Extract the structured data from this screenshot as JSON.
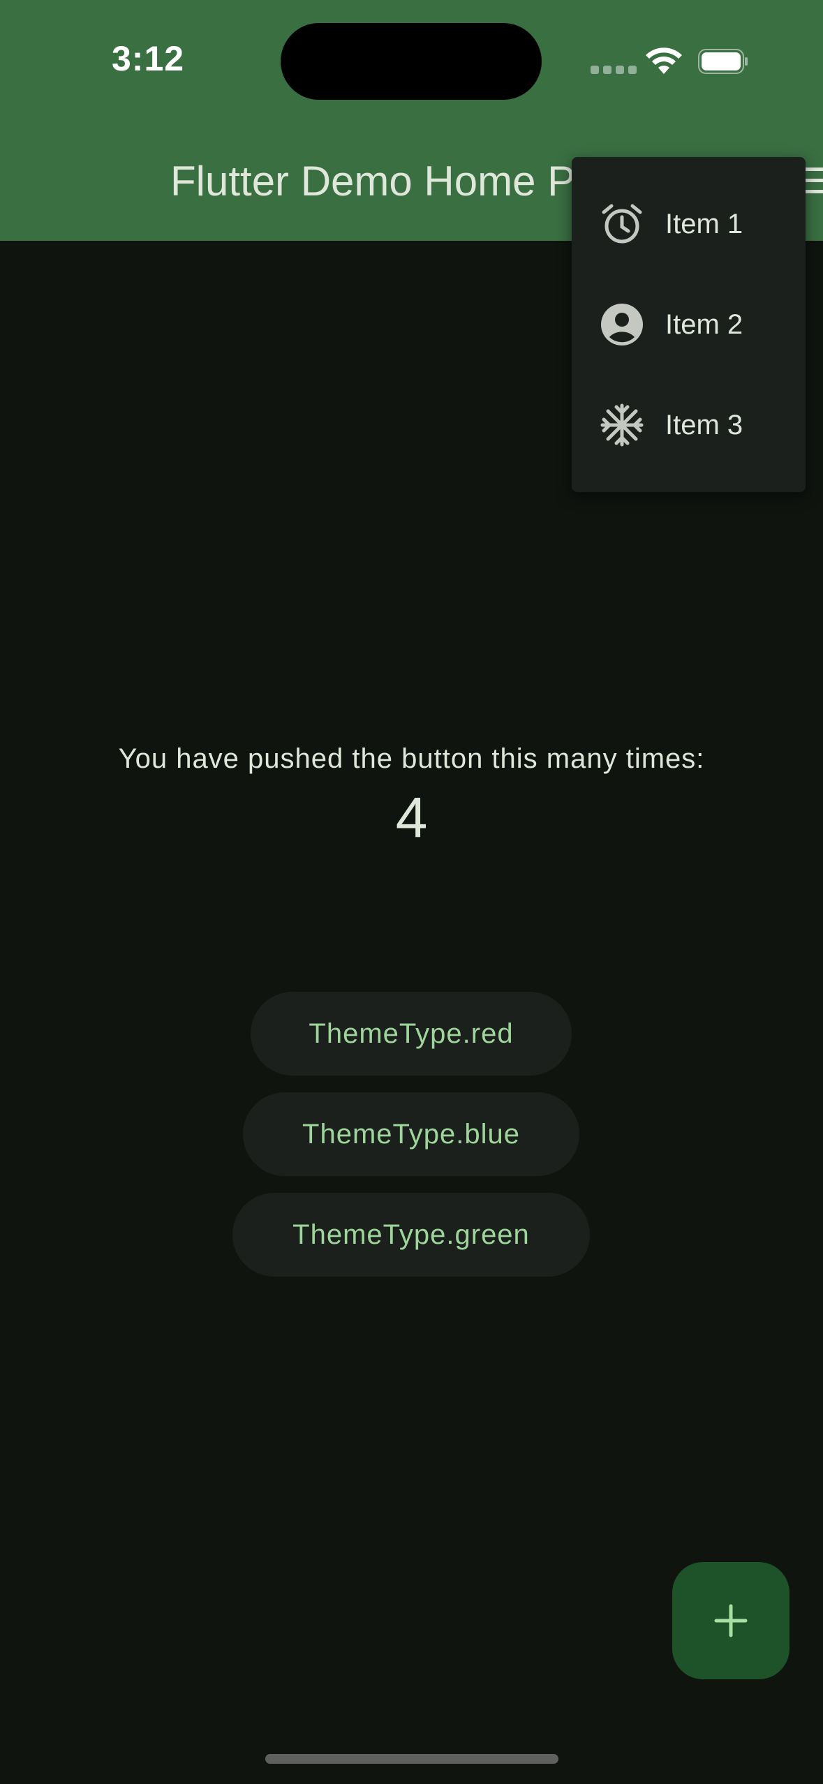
{
  "status_bar": {
    "time": "3:12"
  },
  "app_bar": {
    "title": "Flutter Demo Home Page",
    "background": "#3a6f42"
  },
  "popup_menu": {
    "items": [
      {
        "label": "Item 1",
        "icon": "alarm-icon"
      },
      {
        "label": "Item 2",
        "icon": "account-circle-icon"
      },
      {
        "label": "Item 3",
        "icon": "snowflake-icon"
      }
    ]
  },
  "main": {
    "caption": "You have pushed the button this many times:",
    "count": "4",
    "theme_buttons": [
      {
        "label": "ThemeType.red"
      },
      {
        "label": "ThemeType.blue"
      },
      {
        "label": "ThemeType.green"
      }
    ]
  },
  "fab": {
    "icon": "add-icon",
    "color": "#1e5229"
  }
}
